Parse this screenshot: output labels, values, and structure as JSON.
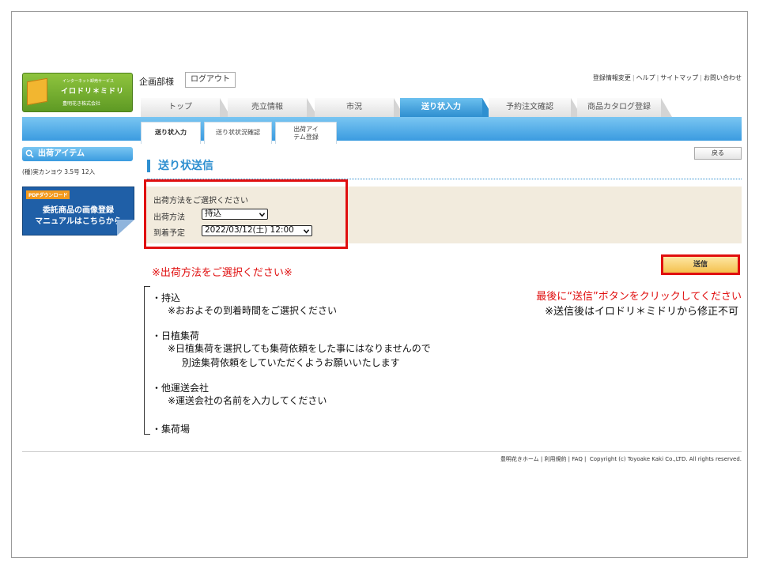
{
  "logo": {
    "small_text": "インターネット卸売サービス",
    "name": "イロドリ＊ミドリ",
    "company": "豊明花き株式会社"
  },
  "header": {
    "user_name": "企画部様",
    "logout_label": "ログアウト",
    "links": [
      "登録情報変更",
      "ヘルプ",
      "サイトマップ",
      "お問い合わせ"
    ]
  },
  "tabs": [
    {
      "label": "トップ",
      "active": false
    },
    {
      "label": "売立情報",
      "active": false
    },
    {
      "label": "市況",
      "active": false
    },
    {
      "label": "送り状入力",
      "active": true
    },
    {
      "label": "予約注文確認",
      "active": false
    },
    {
      "label": "商品カタログ登録",
      "active": false
    }
  ],
  "subtabs": [
    {
      "label": "送り状入力",
      "active": true
    },
    {
      "label": "送り状状況確認",
      "active": false
    },
    {
      "label": "出荷アイ",
      "label2": "テム登録",
      "active": false
    }
  ],
  "sidebar": {
    "heading": "出荷アイテム",
    "item_text": "(種)実カンヨウ 3.5号 12入",
    "pdf_banner": {
      "tag": "PDFダウンロード",
      "line1": "委託商品の画像登録",
      "line2": "マニュアルはこちらから"
    }
  },
  "main": {
    "back_label": "戻る",
    "title": "送り状送信",
    "form": {
      "prompt": "出荷方法をご選択ください",
      "method_label": "出荷方法",
      "method_value": "持込",
      "arrival_label": "到着予定",
      "arrival_value": "2022/03/12(土) 12:00"
    },
    "send_label": "送信",
    "red_note": "※出荷方法をご選択ください※",
    "options": [
      {
        "name": "・持込",
        "notes": [
          "※おおよその到着時間をご選択ください"
        ]
      },
      {
        "name": "・日植集荷",
        "notes": [
          "※日植集荷を選択しても集荷依頼をした事にはなりませんので",
          "別途集荷依頼をしていただくようお願いいたします"
        ]
      },
      {
        "name": "・他運送会社",
        "notes": [
          "※運送会社の名前を入力してください"
        ]
      },
      {
        "name": "・集荷場",
        "notes": []
      }
    ],
    "right_note1": "最後に“送信”ボタンをクリックしてください",
    "right_note2": "※送信後はイロドリ＊ミドリから修正不可"
  },
  "footer": {
    "links": [
      "豊明花きホーム",
      "利用規約",
      "FAQ"
    ],
    "copyright": "Copyright (c) Toyoake Kaki Co.,LTD. All rights reserved."
  },
  "colors": {
    "accent_blue": "#2e8fd0",
    "highlight_red": "#e00f0f",
    "panel_beige": "#f2ebdd"
  }
}
